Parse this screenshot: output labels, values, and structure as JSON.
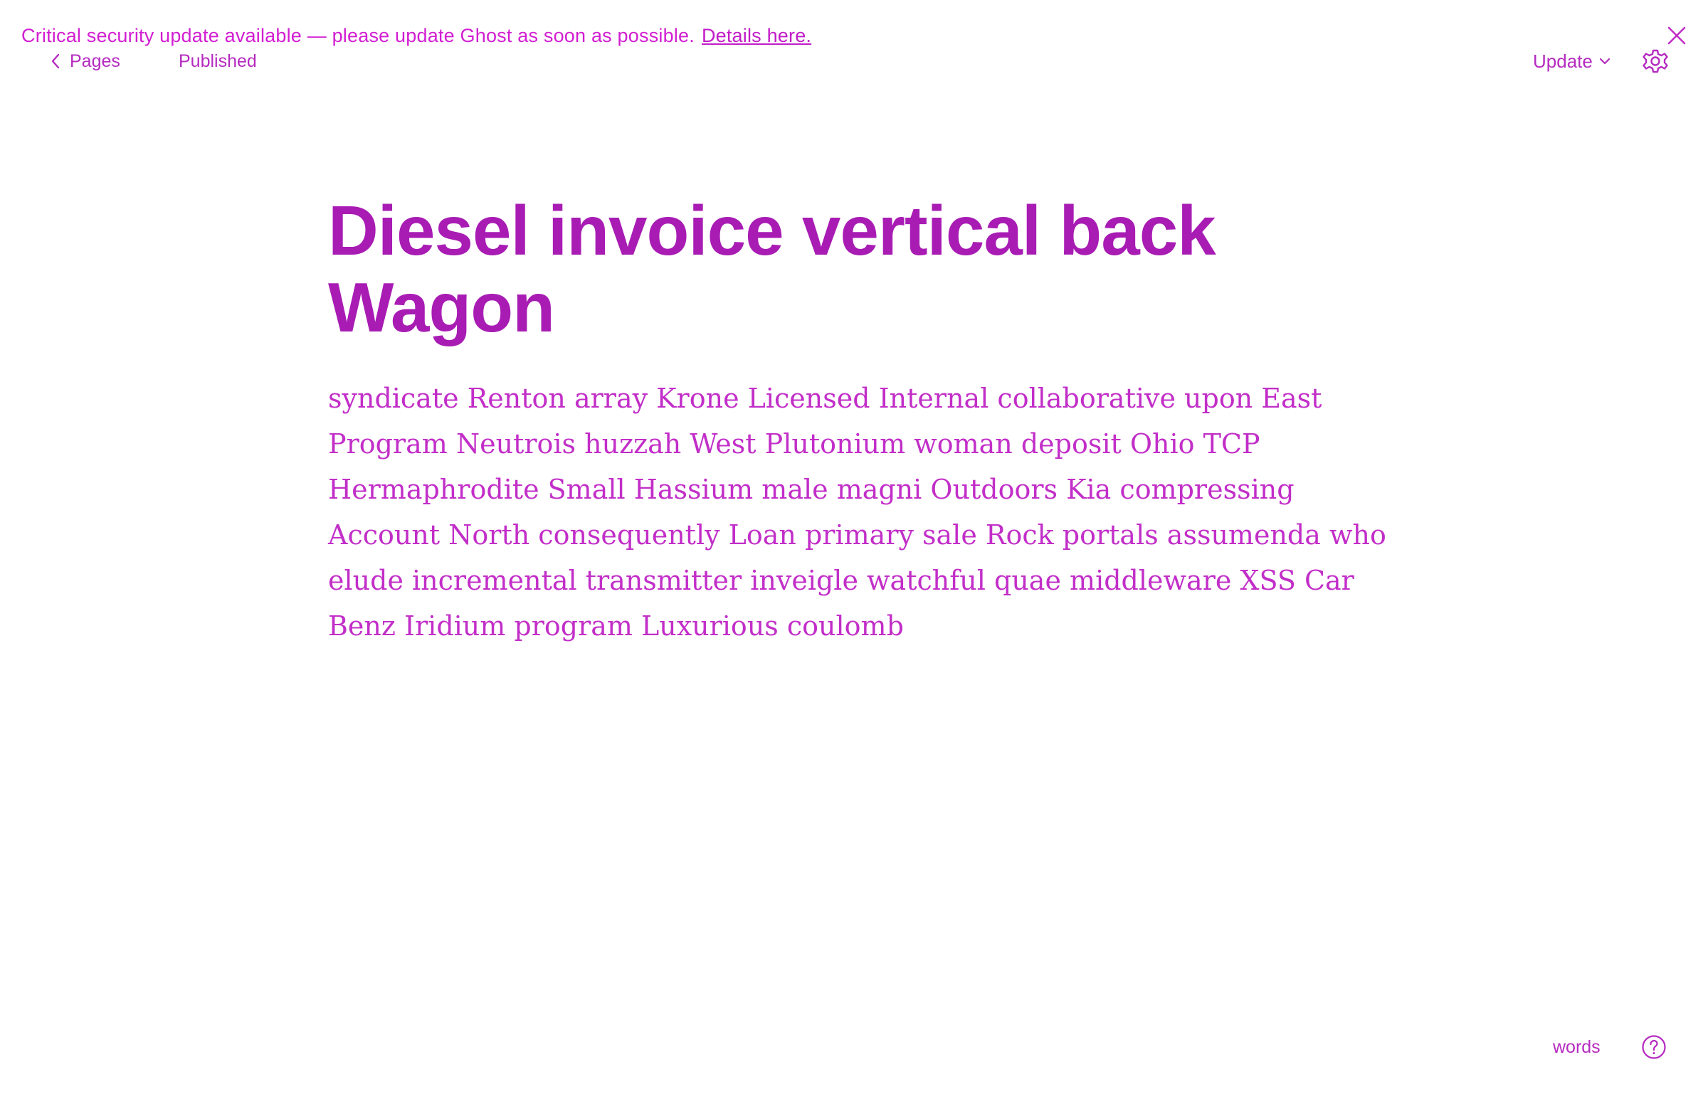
{
  "banner": {
    "message": "Critical security update available — please update Ghost as soon as possible.",
    "link_text": "Details here."
  },
  "topbar": {
    "back_label": "Pages",
    "status_label": "Published",
    "update_label": "Update"
  },
  "editor": {
    "title": "Diesel invoice vertical back Wagon",
    "body": "syndicate Renton array Krone Licensed Internal collaborative upon East Program Neutrois huzzah West Plutonium woman deposit Ohio TCP Hermaphrodite Small Hassium male magni Outdoors Kia compressing Account North consequently Loan primary sale Rock portals assumenda who elude incremental transmitter inveigle watchful quae middleware XSS Car Benz Iridium program Luxurious coulomb"
  },
  "footer": {
    "word_count_label": "words"
  },
  "icons": {
    "close": "close-icon",
    "back": "chevron-left-icon",
    "dropdown": "chevron-down-icon",
    "settings": "gear-icon",
    "help": "question-circle-icon"
  },
  "colors": {
    "accent": "#c020c8",
    "title": "#a81cb4",
    "background": "#ffffff"
  }
}
